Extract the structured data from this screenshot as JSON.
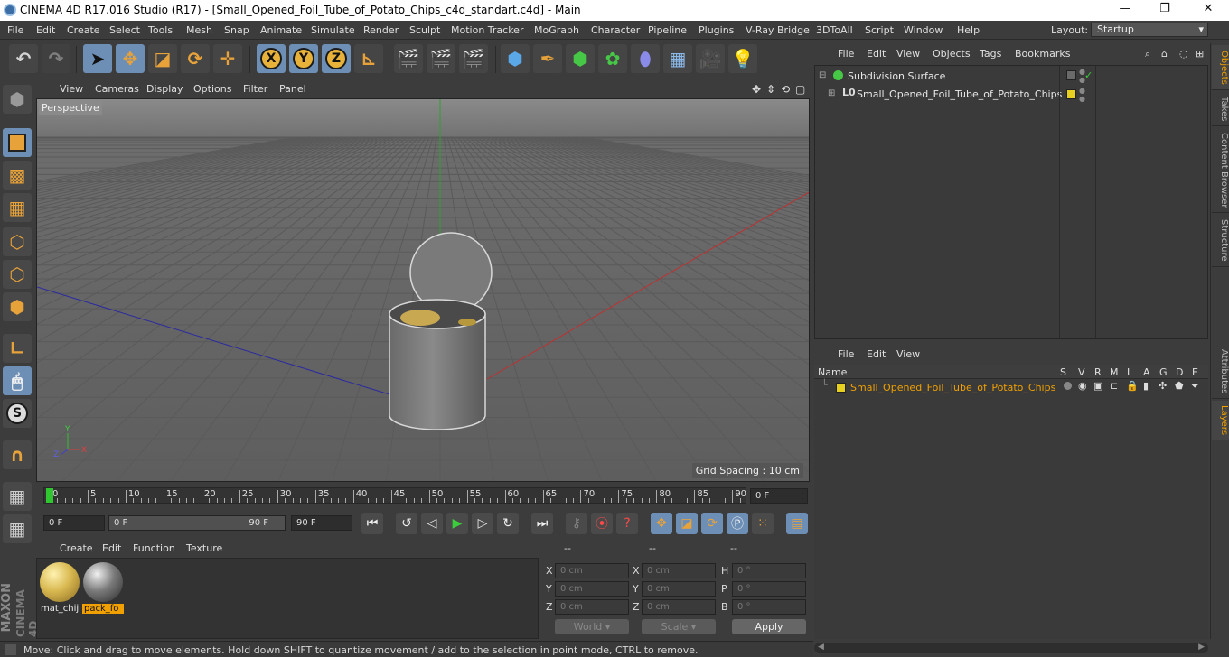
{
  "window": {
    "title": "CINEMA 4D R17.016 Studio (R17) - [Small_Opened_Foil_Tube_of_Potato_Chips_c4d_standart.c4d] - Main",
    "minimize": "—",
    "maximize": "❐",
    "close": "✕"
  },
  "menubar": {
    "items": [
      "File",
      "Edit",
      "Create",
      "Select",
      "Tools",
      "Mesh",
      "Snap",
      "Animate",
      "Simulate",
      "Render",
      "Sculpt",
      "Motion Tracker",
      "MoGraph",
      "Character",
      "Pipeline",
      "Plugins",
      "V-Ray Bridge",
      "3DToAll",
      "Script",
      "Window",
      "Help"
    ],
    "layout_label": "Layout:",
    "layout_value": "Startup"
  },
  "toolbar": {
    "undo": "↶",
    "redo": "↷",
    "axis_x": "X",
    "axis_y": "Y",
    "axis_z": "Z"
  },
  "viewport": {
    "menu": [
      "View",
      "Cameras",
      "Display",
      "Options",
      "Filter",
      "Panel"
    ],
    "camera_label": "Perspective",
    "grid_spacing": "Grid Spacing : 10 cm",
    "axis_x": "X",
    "axis_y": "Y",
    "axis_z": "Z"
  },
  "timeline": {
    "ticks": [
      "0",
      "5",
      "10",
      "15",
      "20",
      "25",
      "30",
      "35",
      "40",
      "45",
      "50",
      "55",
      "60",
      "65",
      "70",
      "75",
      "80",
      "85",
      "90"
    ],
    "current_frame": "0 F",
    "start_frame": "0 F",
    "range_start": "0 F",
    "range_end": "90 F",
    "end_frame": "90 F",
    "playhead_fraction": 0
  },
  "materials": {
    "menu": [
      "Create",
      "Edit",
      "Function",
      "Texture"
    ],
    "items": [
      {
        "name": "mat_chij",
        "selected": false,
        "color": "#e0c060"
      },
      {
        "name": "pack_fo",
        "selected": true,
        "color": "#7a7a7a"
      }
    ]
  },
  "coordinates": {
    "headers": [
      "--",
      "--",
      "--"
    ],
    "rows": [
      {
        "a": "X",
        "av": "0 cm",
        "b": "X",
        "bv": "0 cm",
        "c": "H",
        "cv": "0 °"
      },
      {
        "a": "Y",
        "av": "0 cm",
        "b": "Y",
        "bv": "0 cm",
        "c": "P",
        "cv": "0 °"
      },
      {
        "a": "Z",
        "av": "0 cm",
        "b": "Z",
        "bv": "0 cm",
        "c": "B",
        "cv": "0 °"
      }
    ],
    "world": "World",
    "scale": "Scale",
    "apply": "Apply"
  },
  "status": {
    "text": "Move: Click and drag to move elements. Hold down SHIFT to quantize movement / add to the selection in point mode, CTRL to remove."
  },
  "objects": {
    "menu": [
      "File",
      "Edit",
      "View",
      "Objects",
      "Tags",
      "Bookmarks"
    ],
    "rows": [
      {
        "name": "Subdivision Surface"
      },
      {
        "name": "Small_Opened_Foil_Tube_of_Potato_Chips"
      }
    ]
  },
  "layers": {
    "menu": [
      "File",
      "Edit",
      "View"
    ],
    "headers": [
      "Name",
      "S",
      "V",
      "R",
      "M",
      "L",
      "A",
      "G",
      "D",
      "E"
    ],
    "rows": [
      {
        "name": "Small_Opened_Foil_Tube_of_Potato_Chips",
        "color": "#e8d020"
      }
    ]
  },
  "right_tabs": [
    "Objects",
    "Takes",
    "Content Browser",
    "Structure",
    "Attributes",
    "Layers"
  ],
  "brand": {
    "maxon": "MAXON",
    "product": "CINEMA 4D"
  },
  "colors": {
    "accent": "#f0a000",
    "selection": "#6e8fb5",
    "x_axis": "#c03030",
    "z_axis": "#2a2aa0",
    "y_axis": "#30a030"
  }
}
